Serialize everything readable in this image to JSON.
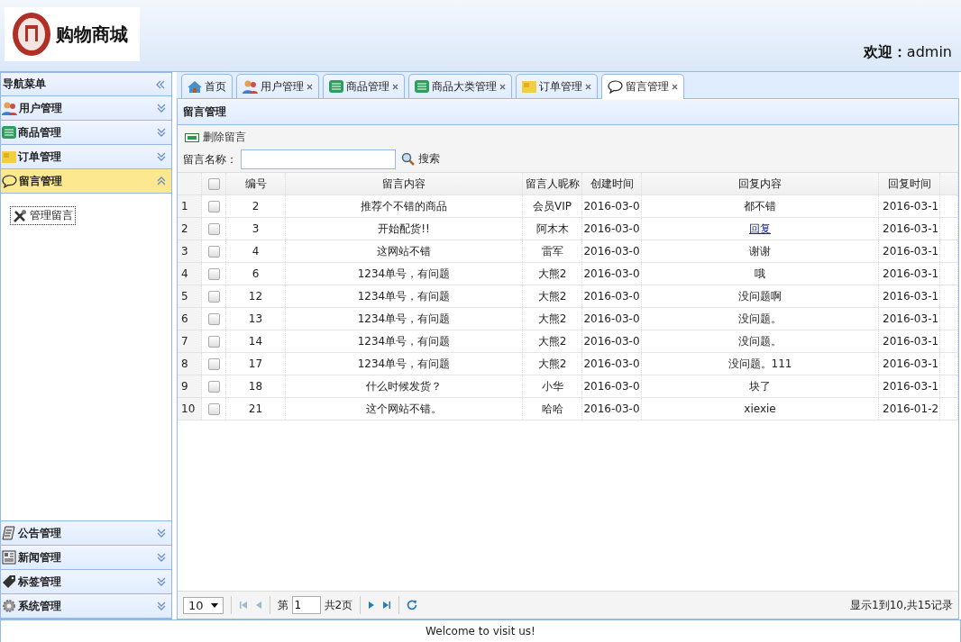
{
  "header": {
    "logo_text": "购物商城",
    "welcome_label": "欢迎：",
    "welcome_user": "admin"
  },
  "sidebar": {
    "title": "导航菜单",
    "groups": [
      {
        "label": "用户管理",
        "expanded": false
      },
      {
        "label": "商品管理",
        "expanded": false
      },
      {
        "label": "订单管理",
        "expanded": false
      },
      {
        "label": "留言管理",
        "expanded": true,
        "children": [
          {
            "label": "管理留言"
          }
        ]
      },
      {
        "label": "公告管理",
        "expanded": false
      },
      {
        "label": "新闻管理",
        "expanded": false
      },
      {
        "label": "标签管理",
        "expanded": false
      },
      {
        "label": "系统管理",
        "expanded": false
      }
    ]
  },
  "tabs": [
    {
      "label": "首页",
      "selected": false,
      "closable": false
    },
    {
      "label": "用户管理",
      "selected": false,
      "closable": true
    },
    {
      "label": "商品管理",
      "selected": false,
      "closable": true
    },
    {
      "label": "商品大类管理",
      "selected": false,
      "closable": true
    },
    {
      "label": "订单管理",
      "selected": false,
      "closable": true
    },
    {
      "label": "留言管理",
      "selected": true,
      "closable": true
    }
  ],
  "panel": {
    "title": "留言管理",
    "delete_button": "删除留言",
    "search_label": "留言名称：",
    "search_button": "搜索"
  },
  "table": {
    "all_checked": false,
    "columns": [
      "编号",
      "留言内容",
      "留言人昵称",
      "创建时间",
      "回复内容",
      "回复时间"
    ],
    "rows": [
      {
        "num": "1",
        "checked": false,
        "cells": [
          "2",
          "推荐个不错的商品",
          "会员VIP",
          "2016-03-0",
          "都不错",
          "2016-03-1"
        ],
        "reply_link": false
      },
      {
        "num": "2",
        "checked": false,
        "cells": [
          "3",
          "开始配货!!",
          "阿木木",
          "2016-03-0",
          "回复",
          "2016-03-1"
        ],
        "reply_link": true
      },
      {
        "num": "3",
        "checked": false,
        "cells": [
          "4",
          "这网站不错",
          "雷军",
          "2016-03-0",
          "谢谢",
          "2016-03-1"
        ],
        "reply_link": false
      },
      {
        "num": "4",
        "checked": false,
        "cells": [
          "6",
          "1234单号，有问题",
          "大熊2",
          "2016-03-0",
          "哦",
          "2016-03-1"
        ],
        "reply_link": false
      },
      {
        "num": "5",
        "checked": false,
        "cells": [
          "12",
          "1234单号，有问题",
          "大熊2",
          "2016-03-0",
          "没问题啊",
          "2016-03-1"
        ],
        "reply_link": false
      },
      {
        "num": "6",
        "checked": false,
        "cells": [
          "13",
          "1234单号，有问题",
          "大熊2",
          "2016-03-0",
          "没问题。",
          "2016-03-1"
        ],
        "reply_link": false
      },
      {
        "num": "7",
        "checked": false,
        "cells": [
          "14",
          "1234单号，有问题",
          "大熊2",
          "2016-03-0",
          "没问题。",
          "2016-03-1"
        ],
        "reply_link": false
      },
      {
        "num": "8",
        "checked": false,
        "cells": [
          "17",
          "1234单号，有问题",
          "大熊2",
          "2016-03-0",
          "没问题。111",
          "2016-03-1"
        ],
        "reply_link": false
      },
      {
        "num": "9",
        "checked": false,
        "cells": [
          "18",
          "什么时候发货？",
          "小华",
          "2016-03-0",
          "块了",
          "2016-03-1"
        ],
        "reply_link": false
      },
      {
        "num": "10",
        "checked": false,
        "cells": [
          "21",
          "这个网站不错。",
          "哈哈",
          "2016-03-0",
          "xiexie",
          "2016-01-2"
        ],
        "reply_link": false
      }
    ]
  },
  "pager": {
    "page_size": "10",
    "page_prefix": "第",
    "page": "1",
    "page_total": "共2页",
    "summary": "显示1到10,共15记录"
  },
  "footer": "Welcome to visit us!"
}
